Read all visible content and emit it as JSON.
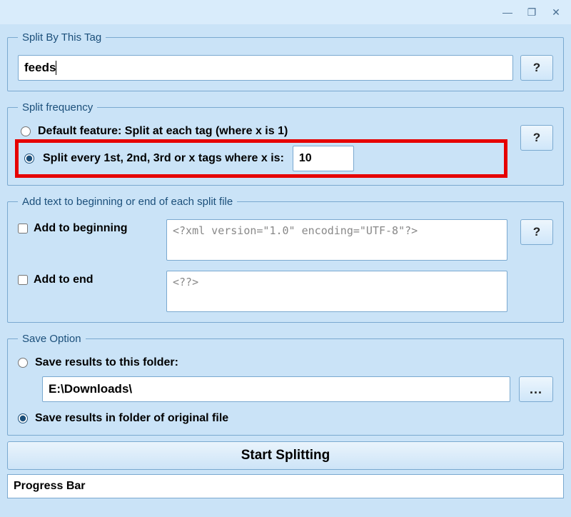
{
  "window": {
    "minimize_glyph": "—",
    "restore_glyph": "❐",
    "close_glyph": "✕"
  },
  "split_tag": {
    "legend": "Split By This Tag",
    "value": "feeds",
    "help": "?"
  },
  "split_freq": {
    "legend": "Split frequency",
    "option_default": "Default feature: Split at each tag (where x is 1)",
    "option_every": "Split every 1st, 2nd, 3rd or x tags where x is:",
    "x_value": "10",
    "selected": "every",
    "help": "?"
  },
  "add_text": {
    "legend": "Add text to beginning or end of each split file",
    "begin_label": "Add to beginning",
    "begin_value": "<?xml version=\"1.0\" encoding=\"UTF-8\"?>",
    "end_label": "Add to end",
    "end_value": "<??>",
    "begin_checked": false,
    "end_checked": false,
    "help": "?"
  },
  "save_option": {
    "legend": "Save Option",
    "to_folder_label": "Save results to this folder:",
    "folder_value": "E:\\Downloads\\",
    "browse_label": "...",
    "original_label": "Save results in folder of original file",
    "selected": "original"
  },
  "start_button": "Start Splitting",
  "progress_label": "Progress Bar"
}
